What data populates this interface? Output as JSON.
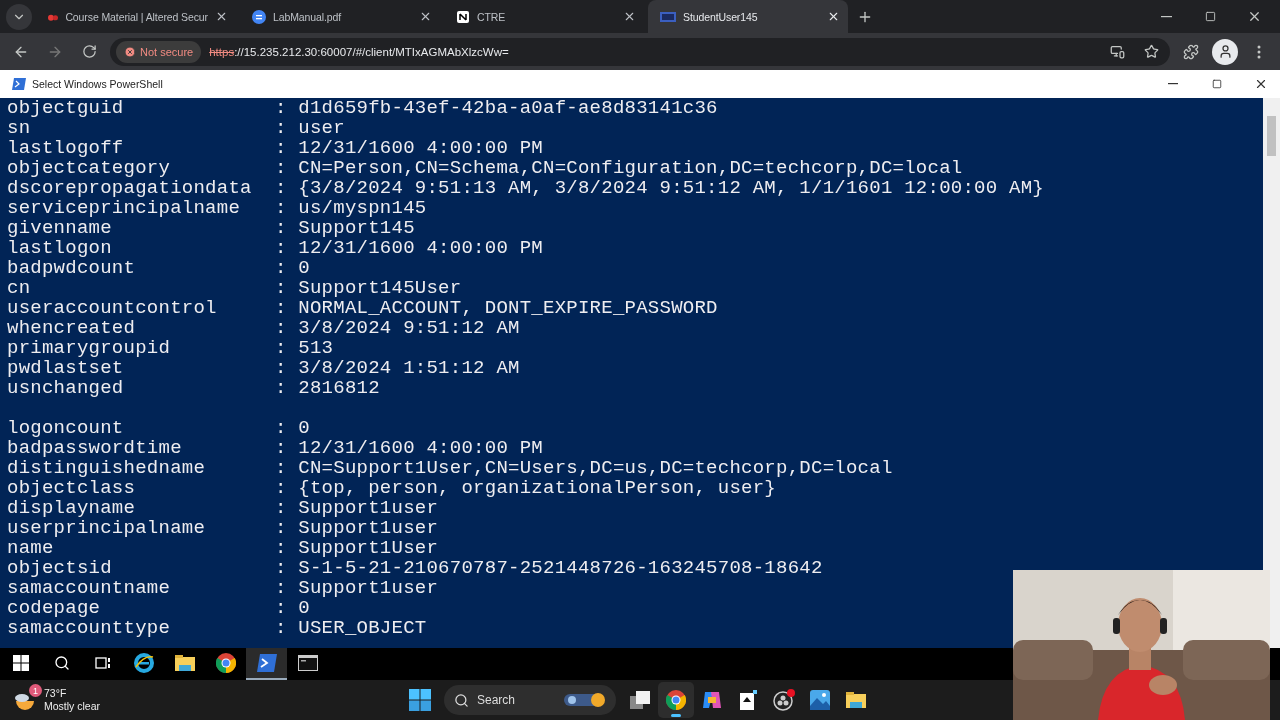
{
  "browser": {
    "tabs": [
      {
        "title": "Course Material | Altered Secur",
        "selected": false
      },
      {
        "title": "LabManual.pdf",
        "selected": false
      },
      {
        "title": "CTRE",
        "selected": false
      },
      {
        "title": "StudentUser145",
        "selected": true
      }
    ],
    "security_chip": "Not secure",
    "url": {
      "scheme": "https",
      "rest": "://15.235.212.30:60007/#/client/MTIxAGMAbXlzcWw="
    }
  },
  "console_window": {
    "title": "Select Windows PowerShell",
    "lines": [
      {
        "kind": "entry",
        "text": "objectguid             : d1d659fb-43ef-42ba-a0af-ae8d83141c36"
      },
      {
        "kind": "entry",
        "text": "sn                     : user"
      },
      {
        "kind": "entry",
        "text": "lastlogoff             : 12/31/1600 4:00:00 PM"
      },
      {
        "kind": "entry",
        "text": "objectcategory         : CN=Person,CN=Schema,CN=Configuration,DC=techcorp,DC=local"
      },
      {
        "kind": "entry",
        "text": "dscorepropagationdata  : {3/8/2024 9:51:13 AM, 3/8/2024 9:51:12 AM, 1/1/1601 12:00:00 AM}"
      },
      {
        "kind": "entry",
        "text": "serviceprincipalname   : us/myspn145"
      },
      {
        "kind": "entry",
        "text": "givenname              : Support145"
      },
      {
        "kind": "entry",
        "text": "lastlogon              : 12/31/1600 4:00:00 PM"
      },
      {
        "kind": "entry",
        "text": "badpwdcount            : 0"
      },
      {
        "kind": "entry",
        "text": "cn                     : Support145User"
      },
      {
        "kind": "entry",
        "text": "useraccountcontrol     : NORMAL_ACCOUNT, DONT_EXPIRE_PASSWORD"
      },
      {
        "kind": "entry",
        "text": "whencreated            : 3/8/2024 9:51:12 AM"
      },
      {
        "kind": "entry",
        "text": "primarygroupid         : 513"
      },
      {
        "kind": "entry",
        "text": "pwdlastset             : 3/8/2024 1:51:12 AM"
      },
      {
        "kind": "entry",
        "text": "usnchanged             : 2816812"
      },
      {
        "kind": "blank"
      },
      {
        "kind": "entry",
        "text": "logoncount             : 0"
      },
      {
        "kind": "entry",
        "text": "badpasswordtime        : 12/31/1600 4:00:00 PM"
      },
      {
        "kind": "entry",
        "text": "distinguishedname      : CN=Support1User,CN=Users,DC=us,DC=techcorp,DC=local"
      },
      {
        "kind": "entry",
        "text": "objectclass            : {top, person, organizationalPerson, user}"
      },
      {
        "kind": "entry",
        "text": "displayname            : Support1user"
      },
      {
        "kind": "entry",
        "text": "userprincipalname      : Support1user"
      },
      {
        "kind": "entry",
        "text": "name                   : Support1User"
      },
      {
        "kind": "entry",
        "text": "objectsid              : S-1-5-21-210670787-2521448726-163245708-18642"
      },
      {
        "kind": "entry",
        "text": "samaccountname         : Support1user"
      },
      {
        "kind": "entry",
        "text": "codepage               : 0"
      },
      {
        "kind": "entry",
        "text": "samaccounttype         : USER_OBJECT"
      }
    ]
  },
  "remote_taskbar": {
    "apps": [
      {
        "kind": "ie",
        "selected": false
      },
      {
        "kind": "explorer",
        "selected": false
      },
      {
        "kind": "chrome",
        "selected": false
      },
      {
        "kind": "powershell",
        "selected": true
      },
      {
        "kind": "cmd",
        "selected": false
      }
    ]
  },
  "host_taskbar": {
    "weather": {
      "temperature": "73°F",
      "condition": "Mostly clear",
      "badge": "1"
    },
    "search_placeholder": "Search",
    "apps": [
      {
        "kind": "taskview",
        "selected": false
      },
      {
        "kind": "chrome",
        "selected": true
      },
      {
        "kind": "copilot",
        "selected": false
      },
      {
        "kind": "solitaire",
        "selected": false
      },
      {
        "kind": "obs",
        "selected": false
      },
      {
        "kind": "photos",
        "selected": false
      },
      {
        "kind": "explorer",
        "selected": false
      }
    ]
  }
}
